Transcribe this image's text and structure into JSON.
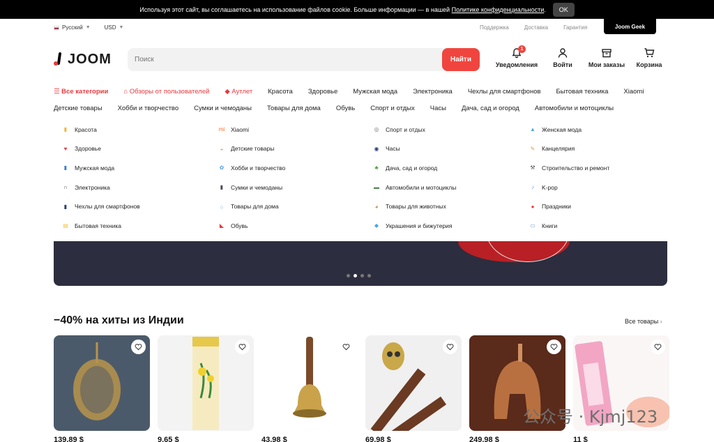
{
  "cookie": {
    "text": "Используя этот сайт, вы соглашаетесь на использование файлов cookie. Больше информации — в нашей",
    "link": "Политике конфиденциальности",
    "link_suffix": ".",
    "ok": "OK"
  },
  "util": {
    "language": "Русский",
    "currency": "USD",
    "links": [
      "Поддержка",
      "Доставка",
      "Гарантия"
    ],
    "geek": "Joom Geek"
  },
  "header": {
    "logo": "JOOM",
    "search_placeholder": "Поиск",
    "search_button": "Найти",
    "notifications_label": "Уведомления",
    "notifications_count": "1",
    "login_label": "Войти",
    "orders_label": "Мои заказы",
    "cart_label": "Корзина"
  },
  "nav1": [
    {
      "label": "Все категории",
      "highlight": true
    },
    {
      "label": "Обзоры от пользователей",
      "highlight": true
    },
    {
      "label": "Аутлет",
      "highlight": true
    },
    {
      "label": "Красота"
    },
    {
      "label": "Здоровье"
    },
    {
      "label": "Мужская мода"
    },
    {
      "label": "Электроника"
    },
    {
      "label": "Чехлы для смартфонов"
    },
    {
      "label": "Бытовая техника"
    },
    {
      "label": "Xiaomi"
    }
  ],
  "nav2": [
    "Детские товары",
    "Хобби и творчество",
    "Сумки и чемоданы",
    "Товары для дома",
    "Обувь",
    "Спорт и отдых",
    "Часы",
    "Дача, сад и огород",
    "Автомобили и мотоциклы"
  ],
  "dropdown": {
    "columns": [
      [
        {
          "label": "Красота",
          "icon": "lipstick-icon",
          "color": "#f4b23c",
          "glyph": "▮"
        },
        {
          "label": "Здоровье",
          "icon": "heart-pulse-icon",
          "color": "#e8383d",
          "glyph": "♥"
        },
        {
          "label": "Мужская мода",
          "icon": "shirt-icon",
          "color": "#3b7fd1",
          "glyph": "▮"
        },
        {
          "label": "Электроника",
          "icon": "headphones-icon",
          "color": "#444444",
          "glyph": "∩"
        },
        {
          "label": "Чехлы для смартфонов",
          "icon": "phone-case-icon",
          "color": "#2c3e70",
          "glyph": "▮"
        },
        {
          "label": "Бытовая техника",
          "icon": "appliance-icon",
          "color": "#f4c542",
          "glyph": "▤"
        }
      ],
      [
        {
          "label": "Xiaomi",
          "icon": "xiaomi-icon",
          "color": "#f36b21",
          "glyph": "mi"
        },
        {
          "label": "Детские товары",
          "icon": "baby-icon",
          "color": "#f08f6b",
          "glyph": "◒"
        },
        {
          "label": "Хобби и творчество",
          "icon": "hobby-icon",
          "color": "#5aa0e0",
          "glyph": "✿"
        },
        {
          "label": "Сумки и чемоданы",
          "icon": "suitcase-icon",
          "color": "#4a4a5a",
          "glyph": "▮"
        },
        {
          "label": "Товары для дома",
          "icon": "home-icon",
          "color": "#8fb5d8",
          "glyph": "⌂"
        },
        {
          "label": "Обувь",
          "icon": "shoe-icon",
          "color": "#e8383d",
          "glyph": "◣"
        }
      ],
      [
        {
          "label": "Спорт и отдых",
          "icon": "bicycle-icon",
          "color": "#777777",
          "glyph": "◎"
        },
        {
          "label": "Часы",
          "icon": "watch-icon",
          "color": "#2c3e70",
          "glyph": "◉"
        },
        {
          "label": "Дача, сад и огород",
          "icon": "garden-icon",
          "color": "#5a9e3a",
          "glyph": "♣"
        },
        {
          "label": "Автомобили и мотоциклы",
          "icon": "car-icon",
          "color": "#5a8a5a",
          "glyph": "▬"
        },
        {
          "label": "Товары для животных",
          "icon": "dog-icon",
          "color": "#c88a4a",
          "glyph": "◕"
        },
        {
          "label": "Украшения и бижутерия",
          "icon": "diamond-icon",
          "color": "#4aa8e0",
          "glyph": "◆"
        }
      ],
      [
        {
          "label": "Женская мода",
          "icon": "dress-icon",
          "color": "#4aa8e0",
          "glyph": "▲"
        },
        {
          "label": "Канцелярия",
          "icon": "stationery-icon",
          "color": "#e0a030",
          "glyph": "✎"
        },
        {
          "label": "Строительство и ремонт",
          "icon": "hammer-icon",
          "color": "#555555",
          "glyph": "⚒"
        },
        {
          "label": "K-pop",
          "icon": "kpop-icon",
          "color": "#5aa0e0",
          "glyph": "♪"
        },
        {
          "label": "Праздники",
          "icon": "balloon-icon",
          "color": "#e8383d",
          "glyph": "●"
        },
        {
          "label": "Книги",
          "icon": "book-icon",
          "color": "#7a9fd0",
          "glyph": "▭"
        }
      ]
    ]
  },
  "banner": {
    "slides": 4,
    "active_slide": 2
  },
  "section": {
    "title": "−40% на хиты из Индии",
    "see_all": "Все товары",
    "products": [
      {
        "price": "139,89 $",
        "bg": "#4b5a6a",
        "fg": "#b8944a",
        "kind": "calligraphy"
      },
      {
        "price": "9,65 $",
        "bg": "#f3f3f3",
        "fg": "#e6c84a",
        "kind": "box"
      },
      {
        "price": "43,98 $",
        "bg": "#ffffff",
        "fg": "#c9a24a",
        "kind": "bell"
      },
      {
        "price": "69,98 $",
        "bg": "#f0f0f0",
        "fg": "#6b3a22",
        "kind": "cane"
      },
      {
        "price": "249,98 $",
        "bg": "#8a2a20",
        "fg": "#b87040",
        "kind": "helmet"
      },
      {
        "price": "11 $",
        "bg": "#faf6f6",
        "fg": "#f2a6c4",
        "kind": "cosmetic"
      }
    ]
  },
  "watermark": "公众号 · Kjmj123"
}
